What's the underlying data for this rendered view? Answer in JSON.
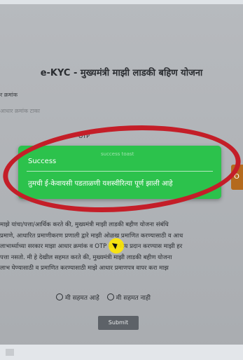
{
  "page": {
    "title": "e-KYC - मुख्यमंत्री माझी लाडकी बहिण योजना",
    "aadhaar_label": "र क्रमांक",
    "aadhaar_placeholder": "आधार क्रमांक टाका",
    "otp_label": "OTP"
  },
  "toast": {
    "watermark": "success toast",
    "title": "Success",
    "message": "तुमची ई-केवायसी पडताळणी यशस्वीरित्या पूर्ण झाली आहे",
    "color": "#2cc24c"
  },
  "right_button_label": "O",
  "consent": {
    "lines": [
      "माझे यांचा/पत्ता/आर्थिक करते की, मुख्यमंत्री माझी लाडकी बहीण योजना संबंधि",
      "प्रमाणे, आधारित प्रमाणीकरण प्रणाली द्वारे माझी ओळख प्रमाणित करण्यासाठी व आध",
      "लाभार्थ्याच्या सरकार माझा आधार क्रमांक व OTP शासकीय प्रदान करण्यास माझी हर",
      "पत्ता नसतो. मी हे देखील सहमत करते की, मुख्यमंत्री माझी लाडकी बहीण योजना",
      "लाभ घेण्यासाठी व प्रमाणित करण्यासाठी माझे आधार प्रमाणपत्र वापर करा माझ"
    ]
  },
  "radios": {
    "agree": "मी सहमत आहे",
    "disagree": "मी सहमत नाही"
  },
  "submit_label": "Submit",
  "colors": {
    "highlight_circle": "#c41e28",
    "cursor": "#ffe800"
  }
}
